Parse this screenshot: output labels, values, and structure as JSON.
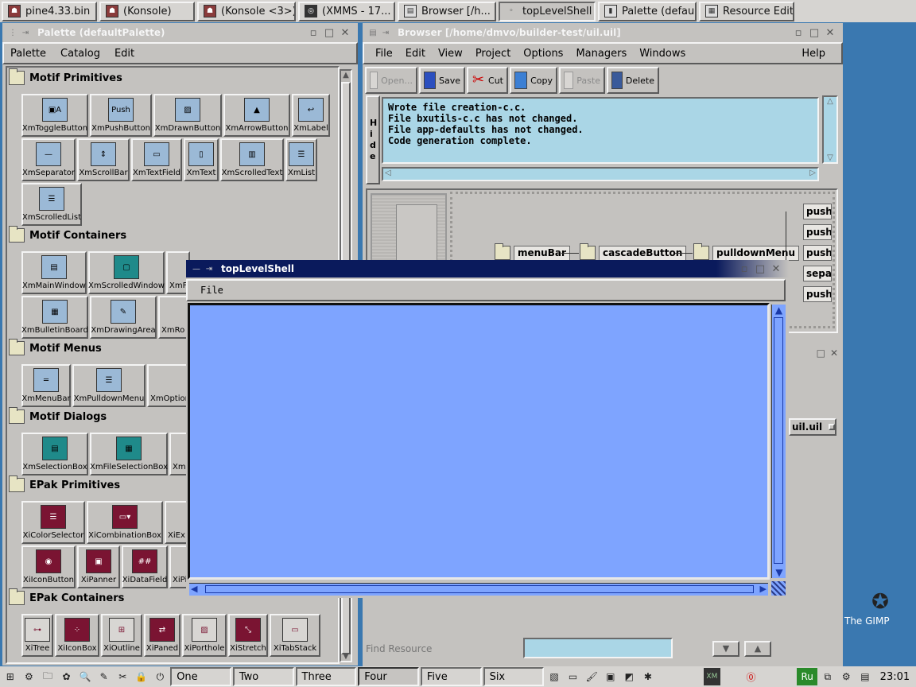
{
  "taskbar": {
    "tasks": [
      {
        "label": "pine4.33.bin",
        "icon": "pine-icon"
      },
      {
        "label": "(Konsole)",
        "icon": "konsole-icon"
      },
      {
        "label": "(Konsole <3>)",
        "icon": "konsole-icon"
      },
      {
        "label": "(XMMS - 17...",
        "icon": "xmms-icon"
      },
      {
        "label": "Browser [/h...",
        "icon": "browser-icon"
      },
      {
        "label": "topLevelShell",
        "icon": "window-icon"
      },
      {
        "label": "Palette (defau...",
        "icon": "palette-icon"
      },
      {
        "label": "Resource Edit...",
        "icon": "resource-editor-icon"
      }
    ],
    "active_task": "topLevelShell"
  },
  "palette": {
    "title": "Palette (defaultPalette)",
    "menu": [
      "Palette",
      "Catalog",
      "Edit"
    ],
    "categories": [
      {
        "name": "Motif Primitives",
        "items": [
          "XmToggleButton",
          "XmPushButton",
          "XmDrawnButton",
          "XmArrowButton",
          "XmLabel",
          "XmSeparator",
          "XmScrollBar",
          "XmTextField",
          "XmText",
          "XmScrolledText",
          "XmList",
          "XmScrolledList"
        ]
      },
      {
        "name": "Motif Containers",
        "items": [
          "XmMainWindow",
          "XmScrolledWindow",
          "XmF",
          "XmBulletinBoard",
          "XmDrawingArea",
          "XmRo"
        ]
      },
      {
        "name": "Motif Menus",
        "items": [
          "XmMenuBar",
          "XmPulldownMenu",
          "XmOption"
        ]
      },
      {
        "name": "Motif Dialogs",
        "items": [
          "XmSelectionBox",
          "XmFileSelectionBox",
          "Xm"
        ]
      },
      {
        "name": "EPak Primitives",
        "items": [
          "XiColorSelector",
          "XiCombinationBox",
          "XiEx",
          "XiIconButton",
          "XiPanner",
          "XiDataField",
          "XiPi"
        ]
      },
      {
        "name": "EPak Containers",
        "items": [
          "XiTree",
          "XiIconBox",
          "XiOutline",
          "XiPaned",
          "XiPorthole",
          "XiStretch",
          "XiTabStack"
        ]
      }
    ]
  },
  "browser": {
    "title": "Browser [/home/dmvo/builder-test/uil.uil]",
    "menu": [
      "File",
      "Edit",
      "View",
      "Project",
      "Options",
      "Managers",
      "Windows"
    ],
    "help": "Help",
    "toolbar": [
      "Open...",
      "Save",
      "Cut",
      "Copy",
      "Paste",
      "Delete"
    ],
    "hide_label": "Hide",
    "messages": [
      "Wrote file creation-c.c.",
      "File bxutils-c.c has not changed.",
      "File app-defaults has not changed.",
      "Code generation complete."
    ],
    "tree": {
      "nodes": [
        "menuBar",
        "cascadeButton",
        "pulldownMenu"
      ],
      "leaves": [
        "push",
        "push",
        "push",
        "separ",
        "push"
      ]
    },
    "uil_file": "uil.uil",
    "find_label": "Find Resource",
    "find_value": ""
  },
  "top_level_shell": {
    "title": "topLevelShell",
    "menu": [
      "File"
    ],
    "canvas_color": "#7ea4ff"
  },
  "desktop": {
    "gimp_label": "The GIMP"
  },
  "panel": {
    "desktops": [
      "One",
      "Two",
      "Three",
      "Four",
      "Five",
      "Six"
    ],
    "current_desktop": "Four",
    "keyboard": "Ru",
    "clock": "23:01"
  }
}
